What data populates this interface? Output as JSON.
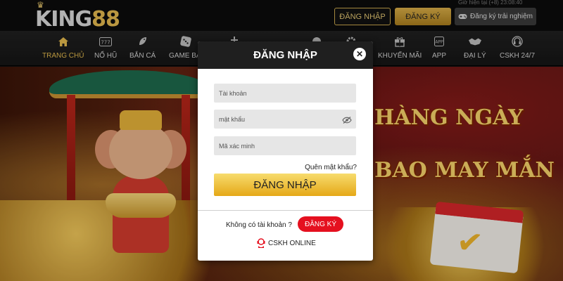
{
  "header": {
    "logo_text": "KING",
    "logo_number": "88",
    "top_info": "Giờ hiện tại (+8) 23:08:40",
    "login_label": "ĐĂNG NHẬP",
    "register_label": "ĐĂNG KÝ",
    "trial_label": "Đăng ký trải nghiệm"
  },
  "nav": {
    "items": [
      {
        "label": "TRANG CHỦ",
        "icon": "home-icon"
      },
      {
        "label": "NỔ HŨ",
        "icon": "slot-icon"
      },
      {
        "label": "BẮN CÁ",
        "icon": "fish-icon"
      },
      {
        "label": "GAME BÀI",
        "icon": "dice-icon"
      },
      {
        "label": "",
        "icon": "cross-icon"
      },
      {
        "label": "",
        "icon": "ball-icon"
      },
      {
        "label": "",
        "icon": "gear-icon"
      },
      {
        "label": "KHUYẾN MÃI",
        "icon": "gift-icon"
      },
      {
        "label": "APP",
        "icon": "phone-icon"
      },
      {
        "label": "ĐẠI LÝ",
        "icon": "handshake-icon"
      },
      {
        "label": "CSKH 24/7",
        "icon": "headset-icon"
      }
    ]
  },
  "hero": {
    "line1": "HÀNG NGÀY",
    "line2": "BAO MAY MẮN"
  },
  "modal": {
    "title": "ĐĂNG NHẬP",
    "username_placeholder": "Tài khoản",
    "password_placeholder": "mật khẩu",
    "captcha_placeholder": "Mã xác minh",
    "forgot_label": "Quên mật khẩu?",
    "submit_label": "ĐĂNG NHẬP",
    "no_account_label": "Không có tài khoản ?",
    "register_label": "ĐĂNG KÝ",
    "support_label": "CSKH ONLINE"
  },
  "colors": {
    "gold": "#e2b94d",
    "modal_header": "#1f1f1f",
    "register_red": "#e5101f"
  }
}
